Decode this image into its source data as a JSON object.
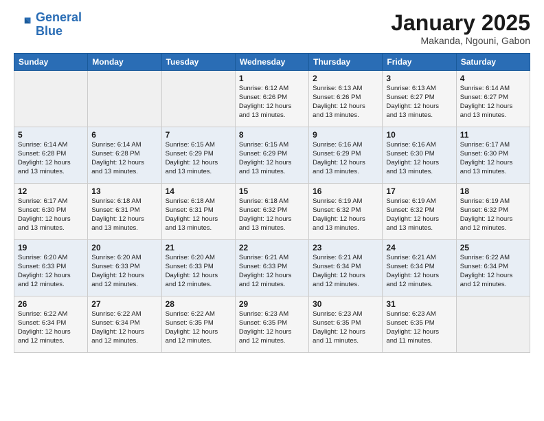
{
  "header": {
    "logo_line1": "General",
    "logo_line2": "Blue",
    "month_title": "January 2025",
    "subtitle": "Makanda, Ngouni, Gabon"
  },
  "days_of_week": [
    "Sunday",
    "Monday",
    "Tuesday",
    "Wednesday",
    "Thursday",
    "Friday",
    "Saturday"
  ],
  "weeks": [
    [
      {
        "day": "",
        "info": ""
      },
      {
        "day": "",
        "info": ""
      },
      {
        "day": "",
        "info": ""
      },
      {
        "day": "1",
        "info": "Sunrise: 6:12 AM\nSunset: 6:26 PM\nDaylight: 12 hours\nand 13 minutes."
      },
      {
        "day": "2",
        "info": "Sunrise: 6:13 AM\nSunset: 6:26 PM\nDaylight: 12 hours\nand 13 minutes."
      },
      {
        "day": "3",
        "info": "Sunrise: 6:13 AM\nSunset: 6:27 PM\nDaylight: 12 hours\nand 13 minutes."
      },
      {
        "day": "4",
        "info": "Sunrise: 6:14 AM\nSunset: 6:27 PM\nDaylight: 12 hours\nand 13 minutes."
      }
    ],
    [
      {
        "day": "5",
        "info": "Sunrise: 6:14 AM\nSunset: 6:28 PM\nDaylight: 12 hours\nand 13 minutes."
      },
      {
        "day": "6",
        "info": "Sunrise: 6:14 AM\nSunset: 6:28 PM\nDaylight: 12 hours\nand 13 minutes."
      },
      {
        "day": "7",
        "info": "Sunrise: 6:15 AM\nSunset: 6:29 PM\nDaylight: 12 hours\nand 13 minutes."
      },
      {
        "day": "8",
        "info": "Sunrise: 6:15 AM\nSunset: 6:29 PM\nDaylight: 12 hours\nand 13 minutes."
      },
      {
        "day": "9",
        "info": "Sunrise: 6:16 AM\nSunset: 6:29 PM\nDaylight: 12 hours\nand 13 minutes."
      },
      {
        "day": "10",
        "info": "Sunrise: 6:16 AM\nSunset: 6:30 PM\nDaylight: 12 hours\nand 13 minutes."
      },
      {
        "day": "11",
        "info": "Sunrise: 6:17 AM\nSunset: 6:30 PM\nDaylight: 12 hours\nand 13 minutes."
      }
    ],
    [
      {
        "day": "12",
        "info": "Sunrise: 6:17 AM\nSunset: 6:30 PM\nDaylight: 12 hours\nand 13 minutes."
      },
      {
        "day": "13",
        "info": "Sunrise: 6:18 AM\nSunset: 6:31 PM\nDaylight: 12 hours\nand 13 minutes."
      },
      {
        "day": "14",
        "info": "Sunrise: 6:18 AM\nSunset: 6:31 PM\nDaylight: 12 hours\nand 13 minutes."
      },
      {
        "day": "15",
        "info": "Sunrise: 6:18 AM\nSunset: 6:32 PM\nDaylight: 12 hours\nand 13 minutes."
      },
      {
        "day": "16",
        "info": "Sunrise: 6:19 AM\nSunset: 6:32 PM\nDaylight: 12 hours\nand 13 minutes."
      },
      {
        "day": "17",
        "info": "Sunrise: 6:19 AM\nSunset: 6:32 PM\nDaylight: 12 hours\nand 13 minutes."
      },
      {
        "day": "18",
        "info": "Sunrise: 6:19 AM\nSunset: 6:32 PM\nDaylight: 12 hours\nand 12 minutes."
      }
    ],
    [
      {
        "day": "19",
        "info": "Sunrise: 6:20 AM\nSunset: 6:33 PM\nDaylight: 12 hours\nand 12 minutes."
      },
      {
        "day": "20",
        "info": "Sunrise: 6:20 AM\nSunset: 6:33 PM\nDaylight: 12 hours\nand 12 minutes."
      },
      {
        "day": "21",
        "info": "Sunrise: 6:20 AM\nSunset: 6:33 PM\nDaylight: 12 hours\nand 12 minutes."
      },
      {
        "day": "22",
        "info": "Sunrise: 6:21 AM\nSunset: 6:33 PM\nDaylight: 12 hours\nand 12 minutes."
      },
      {
        "day": "23",
        "info": "Sunrise: 6:21 AM\nSunset: 6:34 PM\nDaylight: 12 hours\nand 12 minutes."
      },
      {
        "day": "24",
        "info": "Sunrise: 6:21 AM\nSunset: 6:34 PM\nDaylight: 12 hours\nand 12 minutes."
      },
      {
        "day": "25",
        "info": "Sunrise: 6:22 AM\nSunset: 6:34 PM\nDaylight: 12 hours\nand 12 minutes."
      }
    ],
    [
      {
        "day": "26",
        "info": "Sunrise: 6:22 AM\nSunset: 6:34 PM\nDaylight: 12 hours\nand 12 minutes."
      },
      {
        "day": "27",
        "info": "Sunrise: 6:22 AM\nSunset: 6:34 PM\nDaylight: 12 hours\nand 12 minutes."
      },
      {
        "day": "28",
        "info": "Sunrise: 6:22 AM\nSunset: 6:35 PM\nDaylight: 12 hours\nand 12 minutes."
      },
      {
        "day": "29",
        "info": "Sunrise: 6:23 AM\nSunset: 6:35 PM\nDaylight: 12 hours\nand 12 minutes."
      },
      {
        "day": "30",
        "info": "Sunrise: 6:23 AM\nSunset: 6:35 PM\nDaylight: 12 hours\nand 11 minutes."
      },
      {
        "day": "31",
        "info": "Sunrise: 6:23 AM\nSunset: 6:35 PM\nDaylight: 12 hours\nand 11 minutes."
      },
      {
        "day": "",
        "info": ""
      }
    ]
  ]
}
